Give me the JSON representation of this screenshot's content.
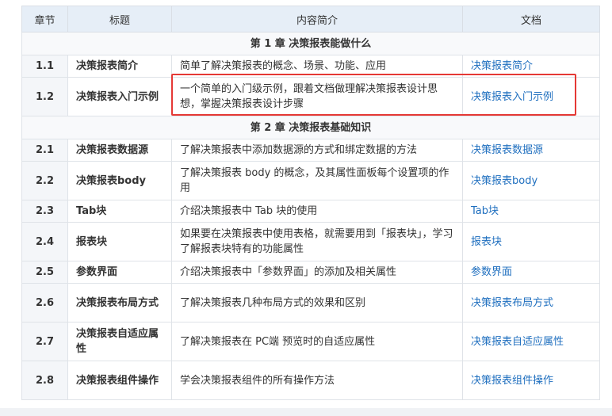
{
  "table": {
    "headers": [
      "章节",
      "标题",
      "内容简介",
      "文档"
    ],
    "chapters": [
      {
        "title": "第 1 章  决策报表能做什么",
        "rows": [
          {
            "num": "1.1",
            "title": "决策报表简介",
            "desc": "简单了解决策报表的概念、场景、功能、应用",
            "doc": "决策报表简介"
          },
          {
            "num": "1.2",
            "title": "决策报表入门示例",
            "desc": "一个简单的入门级示例，跟着文档做理解决策报表设计思想，掌握决策报表设计步骤",
            "doc": "决策报表入门示例"
          }
        ]
      },
      {
        "title": "第 2 章  决策报表基础知识",
        "rows": [
          {
            "num": "2.1",
            "title": "决策报表数据源",
            "desc": "了解决策报表中添加数据源的方式和绑定数据的方法",
            "doc": "决策报表数据源"
          },
          {
            "num": "2.2",
            "title": "决策报表body",
            "desc": "了解决策报表 body 的概念，及其属性面板每个设置项的作用",
            "doc": "决策报表body"
          },
          {
            "num": "2.3",
            "title": "Tab块",
            "desc": "介绍决策报表中 Tab 块的使用",
            "doc": "Tab块"
          },
          {
            "num": "2.4",
            "title": "报表块",
            "desc": "如果要在决策报表中使用表格，就需要用到「报表块」，学习了解报表块特有的功能属性",
            "doc": "报表块"
          },
          {
            "num": "2.5",
            "title": "参数界面",
            "desc": "介绍决策报表中「参数界面」的添加及相关属性",
            "doc": "参数界面"
          },
          {
            "num": "2.6",
            "title": "决策报表布局方式",
            "desc": "了解决策报表几种布局方式的效果和区别",
            "doc": "决策报表布局方式"
          },
          {
            "num": "2.7",
            "title": "决策报表自适应属性",
            "desc": "了解决策报表在 PC端 预览时的自适应属性",
            "doc": "决策报表自适应属性"
          },
          {
            "num": "2.8",
            "title": "决策报表组件操作",
            "desc": "学会决策报表组件的所有操作方法",
            "doc": "决策报表组件操作"
          }
        ]
      }
    ]
  },
  "highlight": {
    "color": "#e53935",
    "row": "1.2"
  },
  "colors": {
    "header_bg": "#e6eef7",
    "link": "#1f6fbf",
    "num_bg": "#f4f6f9"
  }
}
